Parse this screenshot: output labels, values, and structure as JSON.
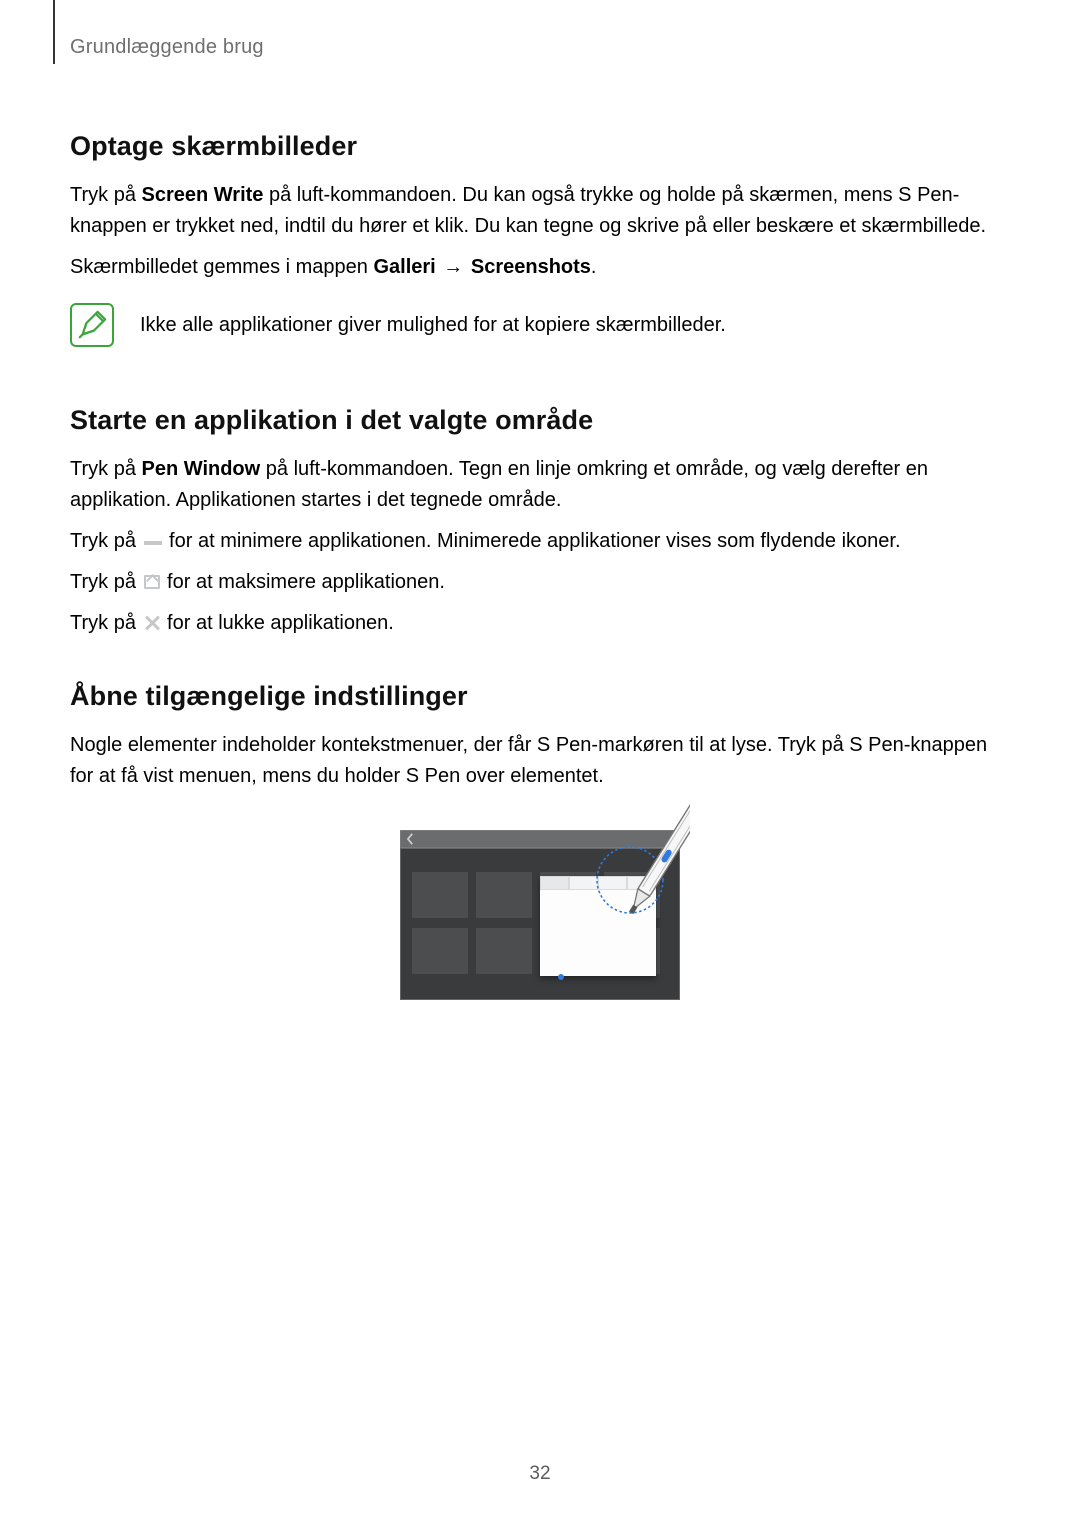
{
  "header": {
    "running_head": "Grundlæggende brug"
  },
  "sec1": {
    "heading": "Optage skærmbilleder",
    "p1_a": "Tryk på ",
    "p1_bold": "Screen Write",
    "p1_b": " på luft-kommandoen. Du kan også trykke og holde på skærmen, mens S Pen-knappen er trykket ned, indtil du hører et klik. Du kan tegne og skrive på eller beskære et skærmbillede.",
    "p2_a": "Skærmbilledet gemmes i mappen ",
    "p2_b1": "Galleri",
    "p2_arrow": " → ",
    "p2_b2": "Screenshots",
    "p2_c": ".",
    "note": "Ikke alle applikationer giver mulighed for at kopiere skærmbilleder."
  },
  "sec2": {
    "heading": "Starte en applikation i det valgte område",
    "p1_a": "Tryk på ",
    "p1_bold": "Pen Window",
    "p1_b": " på luft-kommandoen. Tegn en linje omkring et område, og vælg derefter en applikation. Applikationen startes i det tegnede område.",
    "p2_a": "Tryk på ",
    "p2_b": " for at minimere applikationen. Minimerede applikationer vises som flydende ikoner.",
    "p3_a": "Tryk på ",
    "p3_b": " for at maksimere applikationen.",
    "p4_a": "Tryk på ",
    "p4_b": " for at lukke applikationen."
  },
  "sec3": {
    "heading": "Åbne tilgængelige indstillinger",
    "p1": "Nogle elementer indeholder kontekstmenuer, der får S Pen-markøren til at lyse. Tryk på S Pen-knappen for at få vist menuen, mens du holder S Pen over elementet."
  },
  "page_number": "32"
}
